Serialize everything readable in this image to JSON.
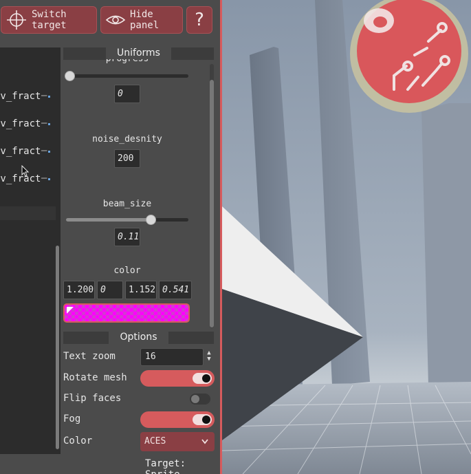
{
  "toolbar": {
    "switch_target_label": "Switch target",
    "hide_panel_label": "Hide panel",
    "help_label": "?"
  },
  "graph": {
    "nodes": [
      {
        "label": "uv_fract",
        "connector": "–"
      },
      {
        "label": "uv_fract",
        "connector": "–"
      },
      {
        "label": "uv_fract",
        "connector": "–"
      },
      {
        "label": "uv_fract",
        "connector": "–"
      }
    ]
  },
  "uniforms": {
    "title": "Uniforms",
    "progress": {
      "label": "progress",
      "value": "0",
      "fraction": 0.0
    },
    "noise_density": {
      "label": "noise_desnity",
      "value": "200"
    },
    "beam_size": {
      "label": "beam_size",
      "value": "0.11",
      "fraction": 0.69
    },
    "color": {
      "label": "color",
      "r": "1.200",
      "g": "0",
      "b": "1.152",
      "a": "0.541",
      "swatch_hex": "#ff00ff"
    }
  },
  "options": {
    "title": "Options",
    "text_zoom": {
      "label": "Text zoom",
      "value": "16"
    },
    "rotate_mesh": {
      "label": "Rotate mesh",
      "on": true
    },
    "flip_faces": {
      "label": "Flip faces",
      "on": false
    },
    "fog": {
      "label": "Fog",
      "on": true
    },
    "color": {
      "label": "Color",
      "value": "ACES"
    }
  },
  "status": {
    "target": "Target: Sprite"
  },
  "colors": {
    "accent": "#d65b5d",
    "button": "#8a3f44",
    "panel": "#4b4b4b"
  }
}
